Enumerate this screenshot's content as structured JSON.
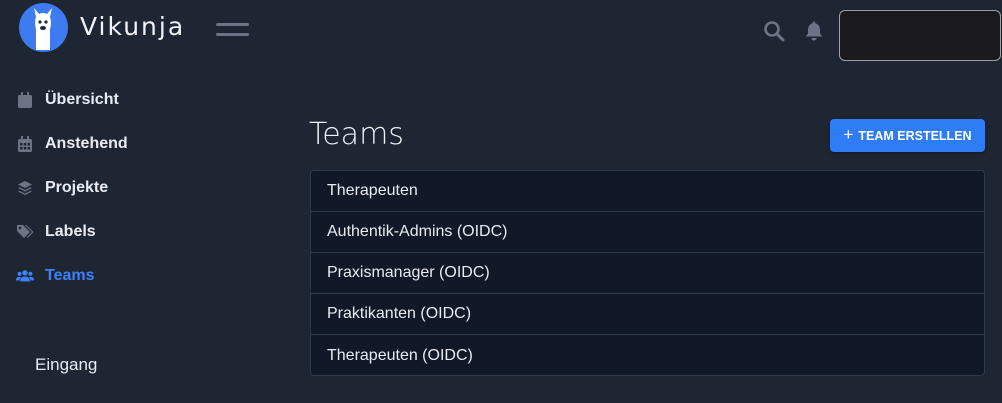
{
  "app": {
    "brand": "Vikunja"
  },
  "header": {
    "icons": [
      "hamburger-icon",
      "search-icon",
      "bell-icon"
    ]
  },
  "sidebar": {
    "items": [
      {
        "label": "Übersicht",
        "icon": "calendar-icon",
        "active": false
      },
      {
        "label": "Anstehend",
        "icon": "calendar-grid-icon",
        "active": false
      },
      {
        "label": "Projekte",
        "icon": "layers-icon",
        "active": false
      },
      {
        "label": "Labels",
        "icon": "tags-icon",
        "active": false
      },
      {
        "label": "Teams",
        "icon": "users-icon",
        "active": true
      }
    ],
    "section_label": "Eingang"
  },
  "main": {
    "title": "Teams",
    "create_button": {
      "icon": "+",
      "label": "TEAM ERSTELLEN"
    },
    "teams": [
      "Therapeuten",
      "Authentik-Admins (OIDC)",
      "Praxismanager (OIDC)",
      "Praktikanten (OIDC)",
      "Therapeuten (OIDC)"
    ]
  },
  "colors": {
    "background": "#1e2533",
    "accent": "#3b82f6",
    "list_background": "#111827"
  }
}
